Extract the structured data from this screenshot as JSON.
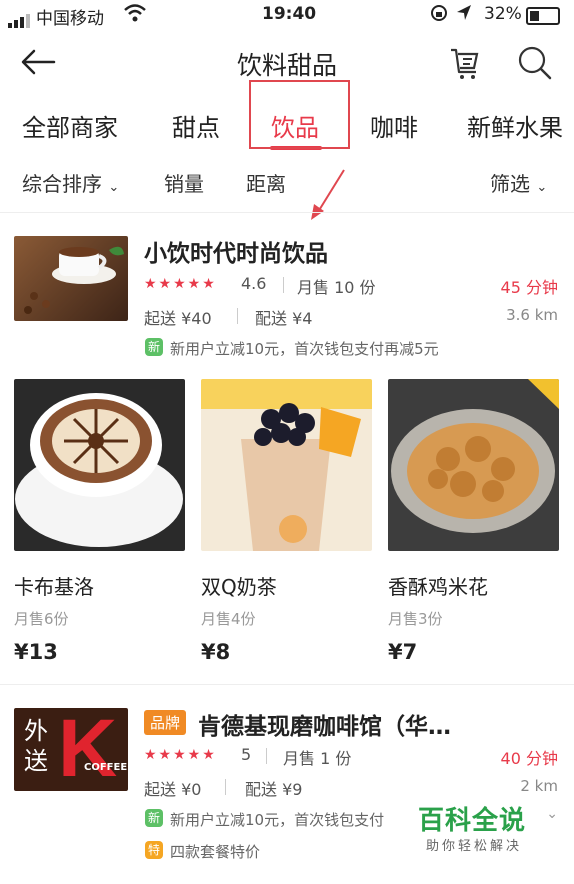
{
  "status_bar": {
    "carrier": "中国移动",
    "time": "19:40",
    "battery": "32%"
  },
  "header": {
    "title": "饮料甜品",
    "back_icon": "back-arrow-icon",
    "list_icon": "order-list-icon",
    "search_icon": "search-icon"
  },
  "tabs": [
    {
      "label": "全部商家"
    },
    {
      "label": "甜点"
    },
    {
      "label": "饮品",
      "active": true
    },
    {
      "label": "咖啡"
    },
    {
      "label": "新鲜水果"
    }
  ],
  "sort_bar": {
    "comprehensive": "综合排序",
    "sales": "销量",
    "distance": "距离",
    "filter": "筛选"
  },
  "accent_color": "#e83a4a",
  "stores": [
    {
      "name": "小饮时代时尚饮品",
      "rating": "4.6",
      "monthly_sales": "月售 10 份",
      "delivery_time": "45 分钟",
      "min_order": "起送 ¥40",
      "delivery_fee": "配送 ¥4",
      "distance": "3.6 km",
      "promo_badge": "新",
      "promo": "新用户立减10元，首次钱包支付再减5元",
      "products": [
        {
          "name": "卡布基洛",
          "sold": "月售6份",
          "price": "¥13"
        },
        {
          "name": "双Q奶茶",
          "sold": "月售4份",
          "price": "¥8"
        },
        {
          "name": "香酥鸡米花",
          "sold": "月售3份",
          "price": "¥7"
        }
      ]
    },
    {
      "brand_tag": "品牌",
      "name": "肯德基现磨咖啡馆（华…",
      "logo_text_1": "外",
      "logo_text_2": "送",
      "logo_k": "K",
      "logo_coffee": "COFFEE",
      "rating": "5",
      "monthly_sales": "月售 1 份",
      "delivery_time": "40 分钟",
      "min_order": "起送 ¥0",
      "delivery_fee": "配送 ¥9",
      "distance": "2 km",
      "promo_badge": "新",
      "promo": "新用户立减10元，首次钱包支付",
      "promo2_badge": "特",
      "promo2": "四款套餐特价"
    }
  ],
  "watermark": {
    "title": "百科全说",
    "subtitle": "助你轻松解决"
  }
}
